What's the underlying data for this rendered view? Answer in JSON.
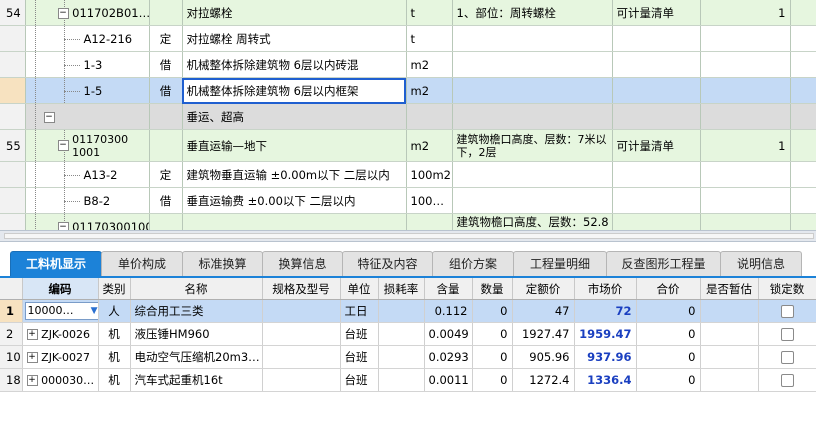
{
  "upper_rows": [
    {
      "kind": "green",
      "rownum": "54",
      "box": "−",
      "code": "011702B01…",
      "cat": "",
      "name": "对拉螺栓",
      "unit": "t",
      "feature": "1、部位：周转螺栓",
      "rule": "可计量清单",
      "qty": "1",
      "indent": 1
    },
    {
      "kind": "white",
      "rownum": "",
      "box": "",
      "code": "A12-216",
      "cat": "定",
      "name": "对拉螺栓 周转式",
      "unit": "t",
      "feature": "",
      "rule": "",
      "qty": "",
      "indent": 2
    },
    {
      "kind": "white",
      "rownum": "",
      "box": "",
      "code": "1-3",
      "cat": "借",
      "name": "机械整体拆除建筑物 6层以内砖混",
      "unit": "m2",
      "feature": "",
      "rule": "",
      "qty": "",
      "indent": 2
    },
    {
      "kind": "sel",
      "rownum": "",
      "box": "",
      "code": "1-5",
      "cat": "借",
      "name": "机械整体拆除建筑物 6层以内框架",
      "unit": "m2",
      "feature": "",
      "rule": "",
      "qty": "",
      "indent": 2
    },
    {
      "kind": "gray",
      "rownum": "",
      "box": "−",
      "code": "",
      "cat": "",
      "name": "垂运、超高",
      "unit": "",
      "feature": "",
      "rule": "",
      "qty": "",
      "indent": 0
    },
    {
      "kind": "green",
      "rownum": "55",
      "box": "−",
      "code": "011703001001",
      "cat": "",
      "name": "垂直运输—地下",
      "unit": "m2",
      "feature": "建筑物檐口高度、层数：7米以下，2层",
      "rule": "可计量清单",
      "qty": "1",
      "indent": 1,
      "tall": true
    },
    {
      "kind": "white",
      "rownum": "",
      "box": "",
      "code": "A13-2",
      "cat": "定",
      "name": "建筑物垂直运输 ±0.00m以下 二层以内",
      "unit": "100m2",
      "feature": "",
      "rule": "",
      "qty": "",
      "indent": 2
    },
    {
      "kind": "white",
      "rownum": "",
      "box": "",
      "code": "B8-2",
      "cat": "借",
      "name": "垂直运输费 ±0.00以下 二层以内",
      "unit": "100…",
      "feature": "",
      "rule": "",
      "qty": "",
      "indent": 2
    },
    {
      "kind": "green",
      "rownum": "",
      "box": "−",
      "code": "01170300100",
      "cat": "",
      "name": "",
      "unit": "",
      "feature": "建筑物檐口高度、层数：52.8",
      "rule": "",
      "qty": "",
      "indent": 1
    }
  ],
  "tabs": [
    "工料机显示",
    "单价构成",
    "标准换算",
    "换算信息",
    "特征及内容",
    "组价方案",
    "工程量明细",
    "反查图形工程量",
    "说明信息"
  ],
  "columns": [
    "",
    "编码",
    "类别",
    "名称",
    "规格及型号",
    "单位",
    "损耗率",
    "含量",
    "数量",
    "定额价",
    "市场价",
    "合价",
    "是否暂估",
    "锁定数"
  ],
  "lower_rows": [
    {
      "rownum": "1",
      "code": "10000…",
      "cat": "人",
      "name": "综合用工三类",
      "spec": "",
      "unit": "工日",
      "loss": "",
      "content": "0.112",
      "amount": "0",
      "quota": "47",
      "market": "72",
      "total": "0",
      "sel": true
    },
    {
      "rownum": "2",
      "code": "ZJK-0026",
      "cat": "机",
      "name": "液压锤HM960",
      "spec": "",
      "unit": "台班",
      "loss": "",
      "content": "0.0049",
      "amount": "0",
      "quota": "1927.47",
      "market": "1959.47",
      "total": "0"
    },
    {
      "rownum": "10",
      "code": "ZJK-0027",
      "cat": "机",
      "name": "电动空气压缩机20m3…",
      "spec": "",
      "unit": "台班",
      "loss": "",
      "content": "0.0293",
      "amount": "0",
      "quota": "905.96",
      "market": "937.96",
      "total": "0"
    },
    {
      "rownum": "18",
      "code": "000030…",
      "cat": "机",
      "name": "汽车式起重机16t",
      "spec": "",
      "unit": "台班",
      "loss": "",
      "content": "0.0011",
      "amount": "0",
      "quota": "1272.4",
      "market": "1336.4",
      "total": "0"
    }
  ]
}
